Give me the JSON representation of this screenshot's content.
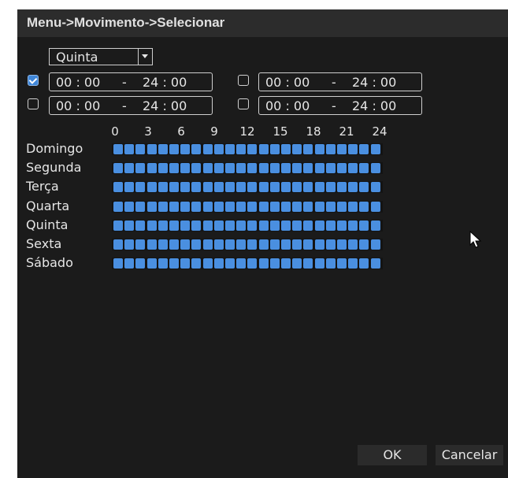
{
  "window": {
    "title": "Menu->Movimento->Selecionar"
  },
  "day_selector": {
    "value": "Quinta"
  },
  "periods": [
    {
      "checked": true,
      "start": "00 : 00",
      "separator": "-",
      "end": "24 : 00"
    },
    {
      "checked": false,
      "start": "00 : 00",
      "separator": "-",
      "end": "24 : 00"
    },
    {
      "checked": false,
      "start": "00 : 00",
      "separator": "-",
      "end": "24 : 00"
    },
    {
      "checked": false,
      "start": "00 : 00",
      "separator": "-",
      "end": "24 : 00"
    }
  ],
  "schedule": {
    "hour_labels": [
      "0",
      "3",
      "6",
      "9",
      "12",
      "15",
      "18",
      "21",
      "24"
    ],
    "days": [
      "Domingo",
      "Segunda",
      "Terça",
      "Quarta",
      "Quinta",
      "Sexta",
      "Sábado"
    ],
    "hours_per_day": 24,
    "selected_hours": "all"
  },
  "buttons": {
    "ok": "OK",
    "cancel": "Cancelar"
  },
  "colors": {
    "accent": "#4a8fe0",
    "background": "#1b1b1b",
    "titlebar": "#2c2c2c"
  },
  "icons": {
    "dropdown": "chevron-down-icon",
    "cursor": "mouse-pointer-icon"
  }
}
